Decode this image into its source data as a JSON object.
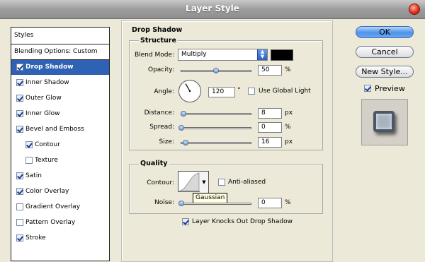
{
  "title": "Layer Style",
  "styles_panel": {
    "header": "Styles",
    "blending": "Blending Options: Custom",
    "items": [
      {
        "label": "Drop Shadow",
        "checked": true,
        "selected": true,
        "indent": false
      },
      {
        "label": "Inner Shadow",
        "checked": true,
        "selected": false,
        "indent": false
      },
      {
        "label": "Outer Glow",
        "checked": true,
        "selected": false,
        "indent": false
      },
      {
        "label": "Inner Glow",
        "checked": true,
        "selected": false,
        "indent": false
      },
      {
        "label": "Bevel and Emboss",
        "checked": true,
        "selected": false,
        "indent": false
      },
      {
        "label": "Contour",
        "checked": true,
        "selected": false,
        "indent": true
      },
      {
        "label": "Texture",
        "checked": false,
        "selected": false,
        "indent": true
      },
      {
        "label": "Satin",
        "checked": true,
        "selected": false,
        "indent": false
      },
      {
        "label": "Color Overlay",
        "checked": true,
        "selected": false,
        "indent": false
      },
      {
        "label": "Gradient Overlay",
        "checked": false,
        "selected": false,
        "indent": false
      },
      {
        "label": "Pattern Overlay",
        "checked": false,
        "selected": false,
        "indent": false
      },
      {
        "label": "Stroke",
        "checked": true,
        "selected": false,
        "indent": false
      }
    ]
  },
  "drop_shadow": {
    "section_title": "Drop Shadow",
    "structure": {
      "title": "Structure",
      "blend_mode_label": "Blend Mode:",
      "blend_mode_value": "Multiply",
      "shadow_color": "#000000",
      "opacity_label": "Opacity:",
      "opacity_value": "50",
      "opacity_unit": "%",
      "opacity_level": 0.5,
      "angle_label": "Angle:",
      "angle_value": "120",
      "angle_unit": "°",
      "angle_degrees": 120,
      "global_light_label": "Use Global Light",
      "global_light_checked": false,
      "distance_label": "Distance:",
      "distance_value": "8",
      "distance_unit": "px",
      "distance_level": 0.03,
      "spread_label": "Spread:",
      "spread_value": "0",
      "spread_unit": "%",
      "spread_level": 0.0,
      "size_label": "Size:",
      "size_value": "16",
      "size_unit": "px",
      "size_level": 0.06
    },
    "quality": {
      "title": "Quality",
      "contour_label": "Contour:",
      "contour_tooltip": "Gaussian",
      "anti_aliased_label": "Anti-aliased",
      "anti_aliased_checked": false,
      "noise_label": "Noise:",
      "noise_value": "0",
      "noise_unit": "%",
      "noise_level": 0.0
    },
    "knockout_label": "Layer Knocks Out Drop Shadow",
    "knockout_checked": true
  },
  "buttons": {
    "ok": "OK",
    "cancel": "Cancel",
    "new_style": "New Style...",
    "preview_label": "Preview",
    "preview_checked": true
  },
  "colors": {
    "selection": "#2f62b4",
    "accent": "#4e92e8"
  }
}
